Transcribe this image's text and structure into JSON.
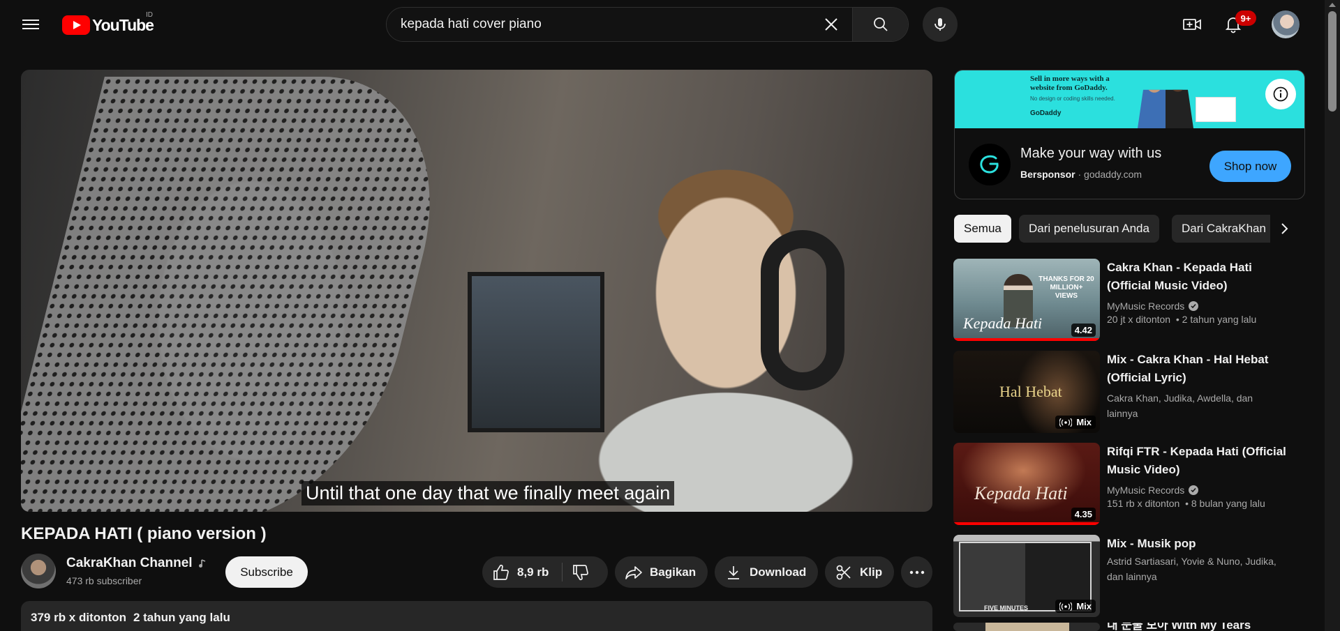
{
  "header": {
    "logo_text": "YouTube",
    "country": "ID",
    "search_value": "kepada hati cover piano",
    "notifications_badge": "9+"
  },
  "player": {
    "caption": "Until that one day that we finally meet again"
  },
  "video": {
    "title": "KEPADA HATI ( piano version )",
    "channel_name": "CakraKhan Channel",
    "subscribers": "473 rb subscriber",
    "subscribe_label": "Subscribe",
    "likes": "8,9 rb",
    "share_label": "Bagikan",
    "download_label": "Download",
    "clip_label": "Klip",
    "views": "379 rb x ditonton",
    "published": "2 tahun yang lalu"
  },
  "ad": {
    "banner_headline": "Sell in more ways with a website from GoDaddy.",
    "banner_sub": "No design or coding skills needed.",
    "banner_brand": "GoDaddy",
    "title": "Make your way with us",
    "sponsor_label": "Bersponsor",
    "domain": "godaddy.com",
    "cta": "Shop now"
  },
  "chips": [
    {
      "label": "Semua",
      "active": true
    },
    {
      "label": "Dari penelusuran Anda",
      "active": false
    },
    {
      "label": "Dari CakraKhan",
      "active": false
    }
  ],
  "recommendations": [
    {
      "title": "Cakra Khan - Kepada Hati (Official Music Video)",
      "channel": "MyMusic Records",
      "verified": true,
      "stats": "20 jt x ditonton",
      "age": "2 tahun yang lalu",
      "duration": "4.42",
      "thumb_text": "THANKS FOR 20 MILLION+ VIEWS",
      "thumb_script": "Kepada Hati"
    },
    {
      "title": "Mix - Cakra Khan - Hal Hebat (Official Lyric)",
      "subtitle": "Cakra Khan, Judika, Awdella, dan lainnya",
      "mix_label": "Mix",
      "thumb_text": "Hal Hebat"
    },
    {
      "title": "Rifqi FTR - Kepada Hati (Official Music Video)",
      "channel": "MyMusic Records",
      "verified": true,
      "stats": "151 rb x ditonton",
      "age": "8 bulan yang lalu",
      "duration": "4.35",
      "thumb_text": "Kepada Hati"
    },
    {
      "title": "Mix - Musik pop",
      "subtitle": "Astrid Sartiasari, Yovie & Nuno, Judika, dan lainnya",
      "mix_label": "Mix",
      "thumb_text": "FIVE MINUTES"
    },
    {
      "title": "내 눈물 모아 With My Tears"
    }
  ],
  "colors": {
    "background": "#0f0f0f",
    "accent_red": "#ff0000",
    "ad_banner": "#2be0de",
    "cta_blue": "#3ea6ff"
  }
}
